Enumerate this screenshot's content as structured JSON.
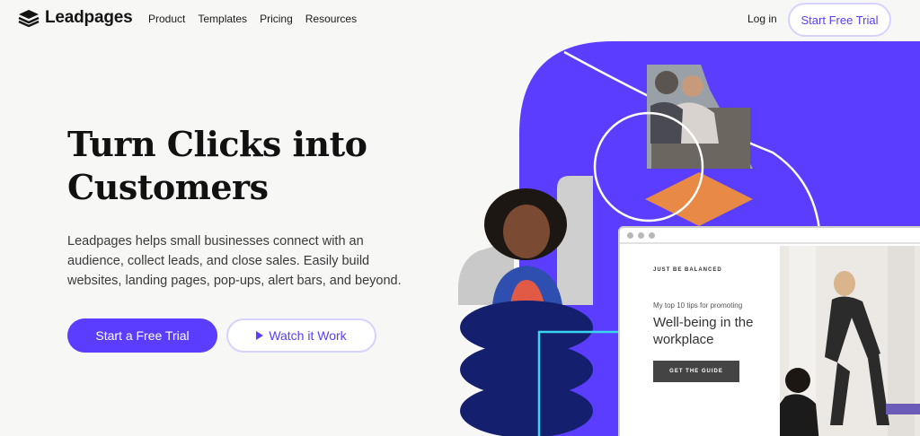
{
  "header": {
    "brand": "Leadpages",
    "nav": [
      "Product",
      "Templates",
      "Pricing",
      "Resources"
    ],
    "login": "Log in",
    "cta": "Start Free Trial"
  },
  "hero": {
    "headline_line1": "Turn Clicks into",
    "headline_line2": "Customers",
    "subtext": "Leadpages helps small businesses connect with an audience, collect leads, and close sales. Easily build websites, landing pages, pop-ups, alert bars, and beyond.",
    "primary_button": "Start a Free Trial",
    "secondary_button": "Watch it Work"
  },
  "preview_card": {
    "kicker": "JUST BE BALANCED",
    "small_text": "My top 10 tips for promoting",
    "title": "Well-being in the workplace",
    "button": "GET THE GUIDE"
  },
  "colors": {
    "brand_purple": "#5a3dff",
    "navy": "#141f6e",
    "orange": "#e88a45",
    "cyan": "#38d6ee"
  },
  "icons": {
    "logo": "layers-logo-icon",
    "play": "play-icon"
  }
}
